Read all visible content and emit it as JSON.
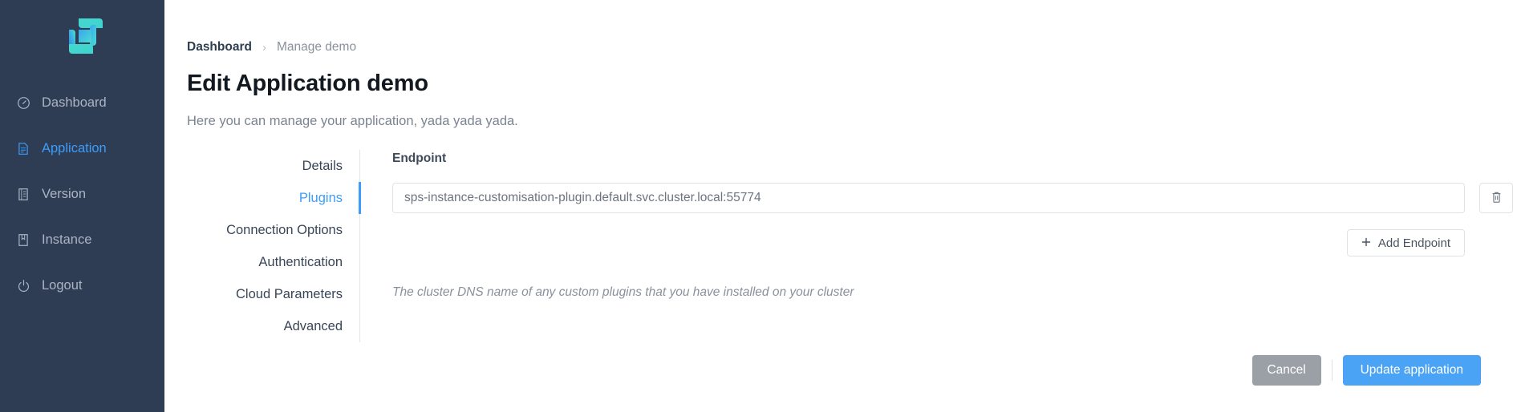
{
  "sidebar": {
    "logo": {
      "icon": "app-logo-pinwheel",
      "colors": [
        "#2f7ef0",
        "#45d8cd"
      ]
    },
    "items": [
      {
        "label": "Dashboard",
        "icon": "dashboard-gauge-icon",
        "active": false
      },
      {
        "label": "Application",
        "icon": "document-icon",
        "active": true
      },
      {
        "label": "Version",
        "icon": "list-book-icon",
        "active": false
      },
      {
        "label": "Instance",
        "icon": "save-book-icon",
        "active": false
      },
      {
        "label": "Logout",
        "icon": "power-icon",
        "active": false
      }
    ],
    "active_color": "#3c9dfa",
    "background": "#2f3d54"
  },
  "breadcrumb": {
    "root": "Dashboard",
    "separator": "›",
    "current": "Manage demo"
  },
  "header": {
    "title": "Edit Application demo",
    "subtitle": "Here you can manage your application, yada yada yada."
  },
  "tabs": [
    {
      "label": "Details",
      "active": false
    },
    {
      "label": "Plugins",
      "active": true
    },
    {
      "label": "Connection Options",
      "active": false
    },
    {
      "label": "Authentication",
      "active": false
    },
    {
      "label": "Cloud Parameters",
      "active": false
    },
    {
      "label": "Advanced",
      "active": false
    }
  ],
  "plugins_panel": {
    "field_label": "Endpoint",
    "endpoint_value": "sps-instance-customisation-plugin.default.svc.cluster.local:55774",
    "endpoint_placeholder": "Endpoint",
    "delete_icon": "trash-icon",
    "add_button": {
      "label": "Add Endpoint",
      "icon": "plus-icon"
    },
    "helper_text": "The cluster DNS name of any custom plugins that you have installed on your cluster"
  },
  "footer": {
    "cancel_label": "Cancel",
    "submit_label": "Update application",
    "submit_color": "#4aa3f5",
    "cancel_color": "#9ba0a6"
  }
}
